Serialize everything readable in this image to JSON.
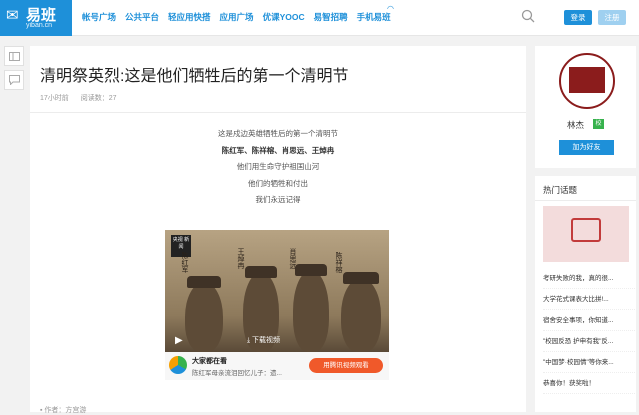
{
  "header": {
    "logo_mark": "✉",
    "logo_name": "易班",
    "logo_sub": "yiban.cn",
    "nav": [
      "帐号广场",
      "公共平台",
      "轻应用快搭",
      "应用广场",
      "优课YOOC",
      "易智招聘",
      "手机易班"
    ],
    "login": "登录",
    "register": "注册"
  },
  "tools": [
    "layout-icon",
    "comment-icon"
  ],
  "article": {
    "title": "清明祭英烈:这是他们牺牲后的第一个清明节",
    "time": "17小时前",
    "read_label": "阅读数：",
    "read_count": "27",
    "lines": [
      {
        "text": "这是戍边英雄牺牲后的第一个清明节",
        "bold": false
      },
      {
        "text": "陈红军、陈祥榕、肖思远、王焯冉",
        "bold": true
      },
      {
        "text": "他们用生命守护祖国山河",
        "bold": false
      },
      {
        "text": "他们的牺牲和付出",
        "bold": false
      },
      {
        "text": "我们永远记得",
        "bold": false
      }
    ],
    "video": {
      "badge": "央视 新闻",
      "names": [
        "陈红军",
        "王焯冉",
        "肖思远",
        "陈祥榕"
      ],
      "download": "⤓ 下载视频",
      "promo_title": "大家都在看",
      "promo_sub": "陈红军母亲流泪回忆儿子：遗...",
      "promo_cta": "用腾讯视频观看"
    },
    "footer": "▪ 作者：方宫游"
  },
  "sidebar": {
    "user": "林杰",
    "school_badge": "校",
    "add_friend": "加为好友",
    "hot_title": "热门话题",
    "hot_items": [
      "考研失败的我，真的很...",
      "大学花式课表大比拼!...",
      "宿舍安全事项，你知道...",
      "\"校园反恐 护申有我\"反...",
      "\"中国梦·校园情\"等你来...",
      "恭喜你！获奖啦！"
    ]
  }
}
